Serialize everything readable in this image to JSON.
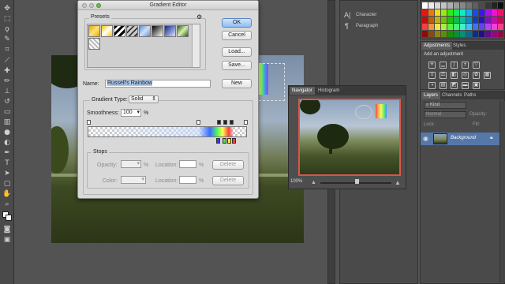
{
  "dialog": {
    "title": "Gradient Editor",
    "presets_label": "Presets",
    "ok": "OK",
    "cancel": "Cancel",
    "load": "Load...",
    "save": "Save...",
    "name_label": "Name:",
    "name_value": "Russell's Rainbow",
    "new": "New",
    "gradient_type_label": "Gradient Type:",
    "gradient_type_value": "Solid",
    "smoothness_label": "Smoothness:",
    "smoothness_value": "100",
    "percent": "%",
    "stops": {
      "label": "Stops",
      "opacity_label": "Opacity:",
      "location_label": "Location:",
      "color_label": "Color:",
      "delete": "Delete",
      "percent": "%"
    }
  },
  "navigator": {
    "tabs": [
      "Navigator",
      "Histogram"
    ],
    "zoom": "100%"
  },
  "right_panel": {
    "character": "Character",
    "paragraph": "Paragraph",
    "char_icon": "A|",
    "para_icon": "¶"
  },
  "adjustments": {
    "tabs": [
      "Adjustments",
      "Styles"
    ],
    "add_label": "Add an adjustment"
  },
  "layers": {
    "tabs": [
      "Layers",
      "Channels",
      "Paths"
    ],
    "kind": "Kind",
    "mode": "Normal",
    "opacity_label": "Opacity:",
    "lock_label": "Lock:",
    "fill_label": "Fill:",
    "layer_name": "Background"
  },
  "colors": {
    "accent": "#5a86c0",
    "name_highlight": "#a9c8f0",
    "layer_selected": "#5577aa"
  }
}
